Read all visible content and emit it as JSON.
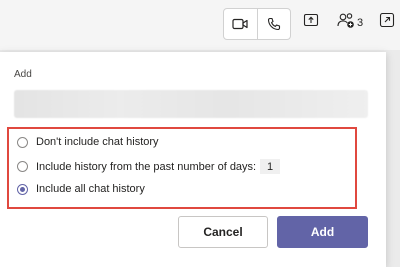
{
  "topbar": {
    "video_icon": "video-camera-icon",
    "phone_icon": "phone-icon",
    "share_icon": "share-screen-icon",
    "people_icon": "people-add-icon",
    "people_count": "3",
    "popout_icon": "pop-out-icon"
  },
  "dialog": {
    "title": "Add",
    "name_input": {
      "value": "",
      "placeholder": ""
    },
    "options": [
      {
        "label": "Don't include chat history",
        "checked": false
      },
      {
        "label": "Include history from the past number of days:",
        "checked": false,
        "days_value": "1"
      },
      {
        "label": "Include all chat history",
        "checked": true
      }
    ],
    "cancel_label": "Cancel",
    "add_label": "Add"
  },
  "colors": {
    "accent": "#6264a7",
    "highlight_border": "#e0483f"
  }
}
